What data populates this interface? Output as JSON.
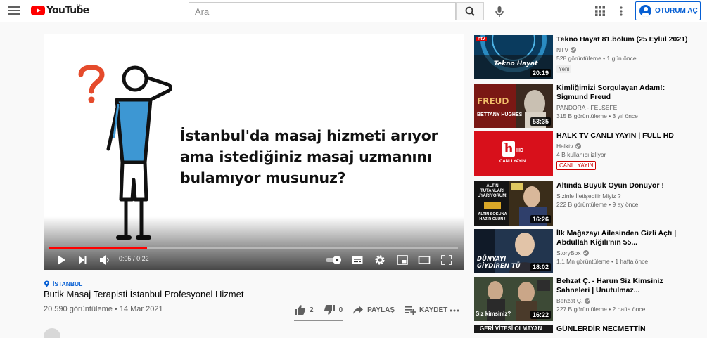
{
  "header": {
    "logo_text": "YouTube",
    "region": "TR",
    "search_placeholder": "Ara",
    "signin_label": "OTURUM AÇ",
    "icons": [
      "menu-icon",
      "search-icon",
      "mic-icon",
      "apps-icon",
      "more-vert-icon",
      "account-icon"
    ]
  },
  "player": {
    "overlay_lines": [
      "İstanbul'da masaj hizmeti arıyor",
      "ama istediğiniz masaj uzmanını",
      "bulamıyor musunuz?"
    ],
    "time_current": "0:05",
    "time_separator": "/",
    "time_total": "0:22",
    "progress": 0.24,
    "accent": "#ff0000"
  },
  "video": {
    "location": "İSTANBUL",
    "title": "Butik Masaj Terapisti İstanbul Profesyonel Hizmet",
    "views": "20.590 görüntüleme",
    "date": "14 Mar 2021",
    "likes": "2",
    "dislikes": "0",
    "share_label": "PAYLAŞ",
    "save_label": "KAYDET"
  },
  "recommendations": [
    {
      "title": "Tekno Hayat 81.bölüm (25 Eylül 2021)",
      "channel": "NTV",
      "verified": true,
      "views": "528 görüntüleme",
      "age": "1 gün önce",
      "badge": "Yeni",
      "duration": "20:19",
      "thumb_text": "Tekno Hayat",
      "thumb_logo": "ntv"
    },
    {
      "title": "Kimliğimizi Sorgulayan Adam!: Sigmund Freud",
      "channel": "PANDORA - FELSEFE",
      "verified": false,
      "views": "315 B görüntüleme",
      "age": "3 yıl önce",
      "duration": "53:35",
      "thumb_text": "FREUD",
      "thumb_sub": "BETTANY HUGHES"
    },
    {
      "title": "HALK TV CANLI YAYIN | FULL HD",
      "channel": "Halktv",
      "verified": true,
      "viewers": "4 B kullanıcı izliyor",
      "live_badge": "CANLI YAYIN",
      "thumb_logo": "h",
      "thumb_hd": "HD",
      "thumb_sub": "CANLI YAYIN"
    },
    {
      "title": "Altında Büyük Oyun Dönüyor !",
      "channel": "Sizinle İletişebilir Miyiz ?",
      "verified": false,
      "views": "222 B görüntüleme",
      "age": "9 ay önce",
      "duration": "16:26",
      "thumb_text": "ALTIN TUTANLARI UYARIYORUM!",
      "thumb_sub": "ALTIN SOKUNA HAZIR OLUN !"
    },
    {
      "title": "İlk Mağazayı Ailesinden Gizli Açtı | Abdullah Kiğılı'nın 55...",
      "channel": "StoryBox",
      "verified": true,
      "views": "1,1 Mn görüntüleme",
      "age": "1 hafta önce",
      "duration": "18:02",
      "thumb_text": "DÜNYAYI GİYDİREN TÜ"
    },
    {
      "title": "Behzat Ç. - Harun Siz Kimsiniz Sahneleri | Unutulmaz...",
      "channel": "Behzat Ç.",
      "verified": true,
      "views": "227 B görüntüleme",
      "age": "2 hafta önce",
      "duration": "16:22",
      "thumb_text": "Siz kimsiniz?"
    },
    {
      "title": "GÜNLERDİR NECMETTİN",
      "thumb_text": "GERİ VİTESİ OLMAYAN"
    }
  ]
}
